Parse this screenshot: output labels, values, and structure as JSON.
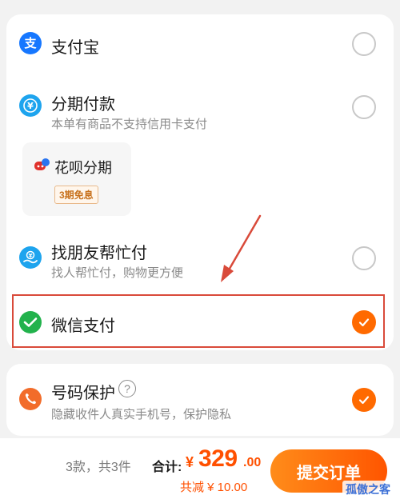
{
  "payment_methods": {
    "alipay": {
      "title": "支付宝",
      "icon": "alipay-icon",
      "color": "#1677ff"
    },
    "installment": {
      "title": "分期付款",
      "subtitle": "本单有商品不支持信用卡支付",
      "icon": "installment-icon",
      "color": "#1ea4ee",
      "option": {
        "title": "花呗分期",
        "badge": "3期免息"
      }
    },
    "friend_pay": {
      "title": "找朋友帮忙付",
      "subtitle": "找人帮忙付，购物更方便",
      "icon": "friend-pay-icon",
      "color": "#1ea4ee"
    },
    "wechat": {
      "title": "微信支付",
      "icon": "wechat-pay-icon",
      "color": "#22b24c",
      "selected": true
    }
  },
  "number_protection": {
    "title": "号码保护",
    "subtitle": "隐藏收件人真实手机号，保护隐私",
    "icon": "phone-shield-icon",
    "help_glyph": "?",
    "enabled": true
  },
  "footer": {
    "summary": "3款，共3件",
    "total_label": "合计:",
    "currency": "¥",
    "total_integer": "329",
    "total_decimal": ".00",
    "discount": "共减 ¥ 10.00",
    "submit_label": "提交订单"
  },
  "watermark": "孤傲之客",
  "accent_color": "#ff6a00",
  "highlight_color": "#d94a3a"
}
